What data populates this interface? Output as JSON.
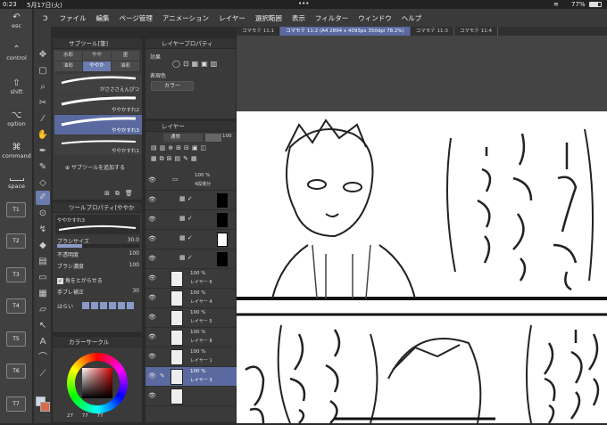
{
  "status_bar": {
    "time": "0:23",
    "date": "5月17日(火)",
    "dots": "•••",
    "battery": "77%"
  },
  "menu": [
    "ファイル",
    "編集",
    "ページ管理",
    "アニメーション",
    "レイヤー",
    "選択範囲",
    "表示",
    "フィルター",
    "ウィンドウ",
    "ヘルプ"
  ],
  "left_column": {
    "esc": "esc",
    "control": "control",
    "shift": "shift",
    "option": "option",
    "command": "command",
    "space": "space",
    "keys": [
      "T1",
      "T2",
      "T3",
      "T4",
      "T5",
      "T6",
      "T7"
    ]
  },
  "subtool_panel": {
    "title": "サブツール[筆]",
    "tabs": [
      "水彩",
      "やや",
      "墨",
      "油彩",
      "ややか",
      "油彩"
    ],
    "brushes": [
      "がさささえんぴつ",
      "ややかすれ2",
      "ややかすれ3",
      "ややかすれ1"
    ],
    "add_label": "サブツールを追加する"
  },
  "tool_property": {
    "title": "ツールプロパティ[ややか",
    "brush_name": "ややかすれ3",
    "rows": [
      {
        "label": "ブラシサイズ",
        "value": "30.0"
      },
      {
        "label": "不透明度",
        "value": "100"
      },
      {
        "label": "ブラシ濃度",
        "value": "100"
      },
      {
        "label": "角をとがらせる",
        "value": ""
      },
      {
        "label": "手ブレ補正",
        "value": "30"
      },
      {
        "label": "はらい",
        "value": ""
      }
    ]
  },
  "color_circle": {
    "title": "カラーサークル",
    "values": [
      "27",
      "77",
      "77"
    ]
  },
  "layer_property": {
    "title": "レイヤープロパティ",
    "effect": "効果",
    "display_color": "表現色",
    "color_mode": "カラー"
  },
  "layer_panel": {
    "title": "レイヤー",
    "blend": "通常",
    "opacity": "100",
    "folder": {
      "pct": "100 %",
      "name": "4段落分"
    },
    "layers": [
      {
        "pct": "100 %",
        "name": "レイヤー 6"
      },
      {
        "pct": "100 %",
        "name": "レイヤー 4"
      },
      {
        "pct": "100 %",
        "name": "レイヤー 5"
      },
      {
        "pct": "100 %",
        "name": "レイヤー 8"
      },
      {
        "pct": "100 %",
        "name": "レイヤー 1"
      },
      {
        "pct": "100 %",
        "name": "レイヤー 3"
      }
    ]
  },
  "tabs": [
    "コマモテ 11:1",
    "コマモテ 11:2 (A4 2894 x 4093px 350dpi 78.2%)",
    "コマモテ 11:3",
    "コマモテ 11:4"
  ]
}
